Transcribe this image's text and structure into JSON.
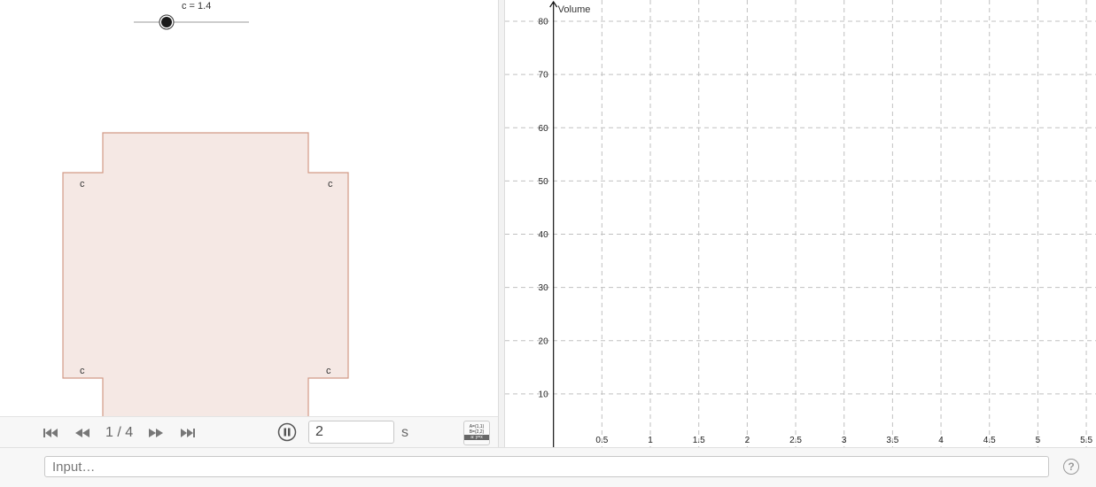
{
  "slider": {
    "label": "c = 1.4",
    "value": 1.4,
    "min": 0,
    "max": 5
  },
  "net": {
    "corner_label": "c",
    "fill": "#f5e8e4",
    "stroke": "#d29a86"
  },
  "playback": {
    "page_indicator": "1 / 4",
    "speed_value": "2",
    "speed_unit": "s",
    "algebra_lines": [
      "A=(1,1)",
      "B=(2,2)",
      "a: y=x"
    ]
  },
  "input_bar": {
    "placeholder": "Input…",
    "help_label": "?"
  },
  "chart_data": {
    "type": "line",
    "title": "",
    "xlabel": "",
    "ylabel": "Volume",
    "xlim": [
      -0.5,
      5.6
    ],
    "ylim": [
      0,
      84
    ],
    "x_ticks": [
      0.5,
      1,
      1.5,
      2,
      2.5,
      3,
      3.5,
      4,
      4.5,
      5,
      5.5
    ],
    "x_tick_labels": [
      "0.5",
      "1",
      "1.5",
      "2",
      "2.5",
      "3",
      "3.5",
      "4",
      "4.5",
      "5",
      "5.5"
    ],
    "y_ticks": [
      10,
      20,
      30,
      40,
      50,
      60,
      70,
      80
    ],
    "y_tick_labels": [
      "10",
      "20",
      "30",
      "40",
      "50",
      "60",
      "70",
      "80"
    ],
    "grid": true,
    "series": []
  }
}
